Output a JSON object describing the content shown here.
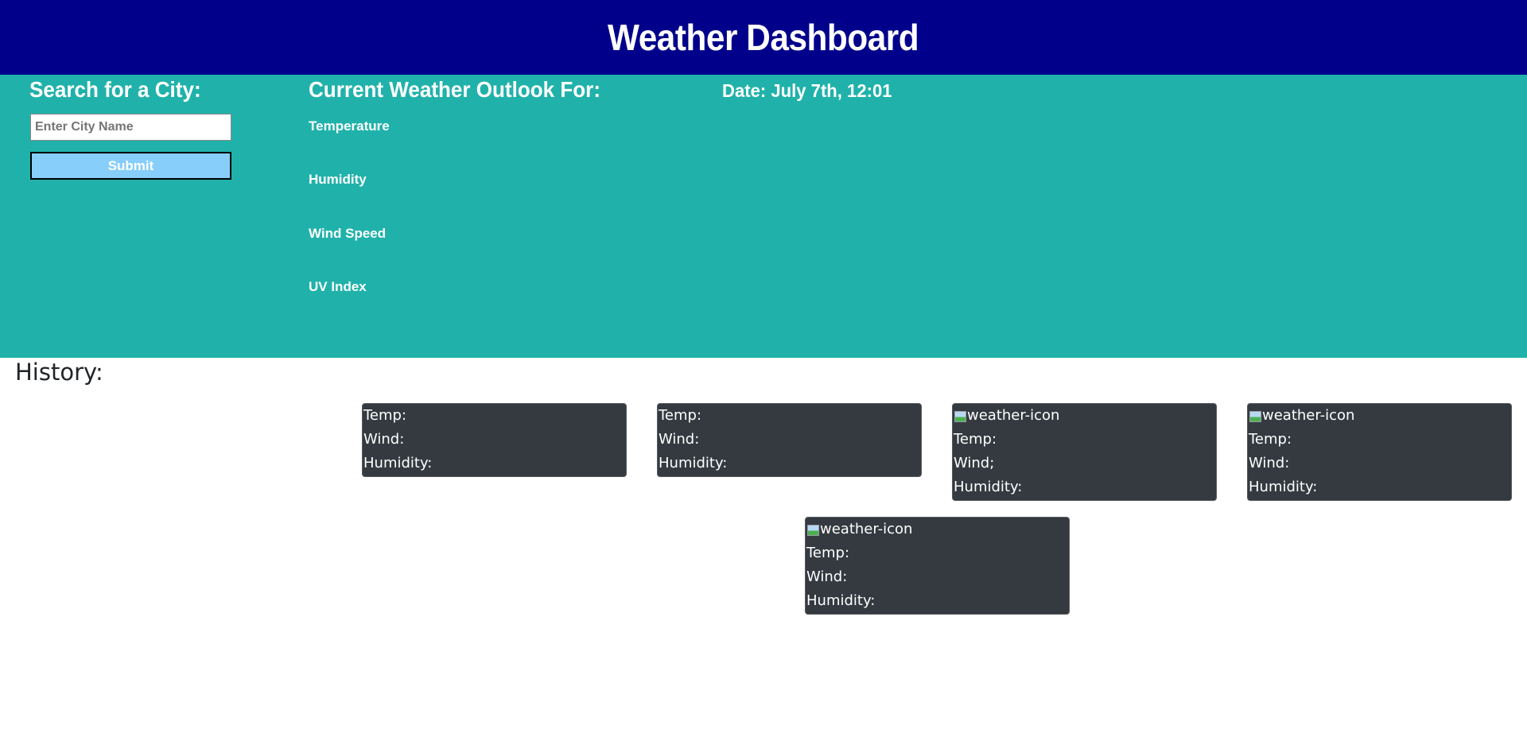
{
  "header": {
    "title": "Weather Dashboard"
  },
  "search": {
    "heading": "Search for a City:",
    "placeholder": "Enter City Name",
    "submit_label": "Submit"
  },
  "current": {
    "heading": "Current Weather Outlook For:",
    "date_label": "Date: July 7th, 12:01",
    "stats": {
      "temperature": "Temperature",
      "humidity": "Humidity",
      "wind_speed": "Wind Speed",
      "uv_index": "UV Index"
    }
  },
  "history": {
    "heading": "History:"
  },
  "forecast": {
    "cards": [
      {
        "icon_alt": "",
        "temp": "Temp:",
        "wind": "Wind:",
        "humidity": "Humidity:"
      },
      {
        "icon_alt": "",
        "temp": "Temp:",
        "wind": "Wind:",
        "humidity": "Humidity:"
      },
      {
        "icon_alt": "weather-icon",
        "temp": "Temp:",
        "wind": "Wind;",
        "humidity": "Humidity:"
      },
      {
        "icon_alt": "weather-icon",
        "temp": "Temp:",
        "wind": "Wind:",
        "humidity": "Humidity:"
      },
      {
        "icon_alt": "weather-icon",
        "temp": "Temp:",
        "wind": "Wind:",
        "humidity": "Humidity:"
      }
    ]
  },
  "colors": {
    "header_bg": "#00008b",
    "panel_bg": "#20b2aa",
    "submit_bg": "#87cefa",
    "card_bg": "#343a40"
  }
}
